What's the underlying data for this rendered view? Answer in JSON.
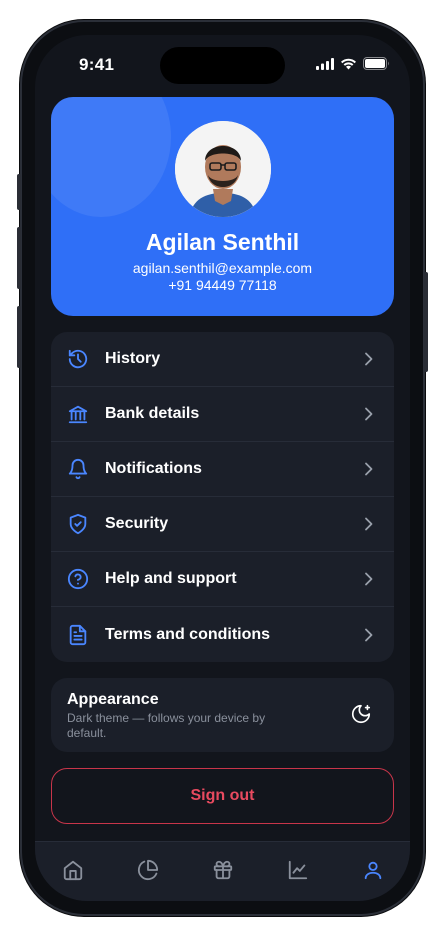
{
  "status_bar": {
    "time": "9:41"
  },
  "profile": {
    "name": "Agilan Senthil",
    "email": "agilan.senthil@example.com",
    "phone": "+91 94449 77118"
  },
  "menu": [
    {
      "label": "History",
      "icon": "history-icon"
    },
    {
      "label": "Bank details",
      "icon": "bank-icon"
    },
    {
      "label": "Notifications",
      "icon": "bell-icon"
    },
    {
      "label": "Security",
      "icon": "shield-check-icon"
    },
    {
      "label": "Help and support",
      "icon": "help-circle-icon"
    },
    {
      "label": "Terms and conditions",
      "icon": "document-icon"
    }
  ],
  "appearance": {
    "title": "Appearance",
    "description": "Dark theme — follows your device by default.",
    "toggle_icon": "moon-sparkle-icon"
  },
  "sign_out_label": "Sign out",
  "tabbar": [
    {
      "name": "home",
      "icon": "home-icon",
      "active": false
    },
    {
      "name": "analytics",
      "icon": "pie-chart-icon",
      "active": false
    },
    {
      "name": "rewards",
      "icon": "gift-icon",
      "active": false
    },
    {
      "name": "trends",
      "icon": "line-chart-icon",
      "active": false
    },
    {
      "name": "profile",
      "icon": "user-icon",
      "active": true
    }
  ],
  "colors": {
    "accent": "#2f6ff7",
    "background": "#12151c",
    "card": "#1b1f29",
    "danger": "#e84a5f",
    "icon_blue": "#4a86ff",
    "muted": "#8a909c"
  }
}
